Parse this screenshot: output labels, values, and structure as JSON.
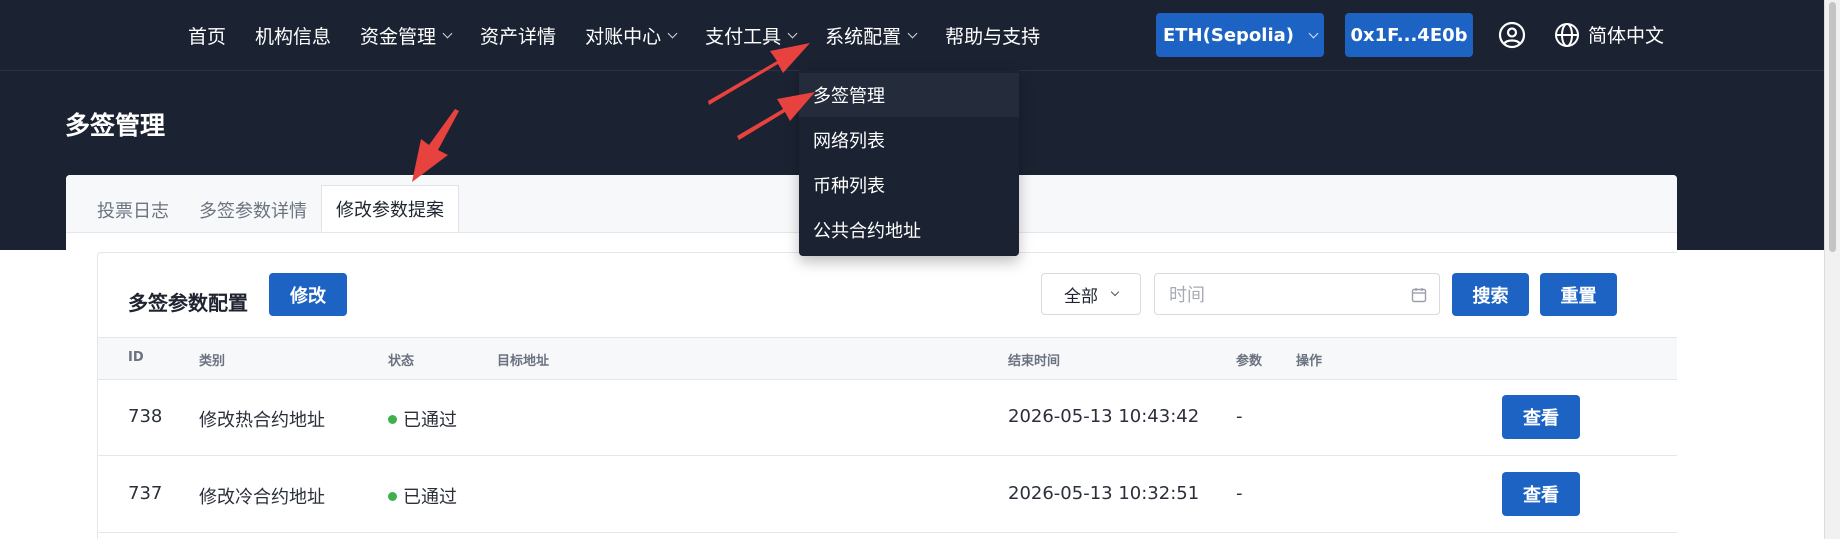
{
  "nav": {
    "items": [
      {
        "label": "首页",
        "dropdown": false
      },
      {
        "label": "机构信息",
        "dropdown": false
      },
      {
        "label": "资金管理",
        "dropdown": true
      },
      {
        "label": "资产详情",
        "dropdown": false
      },
      {
        "label": "对账中心",
        "dropdown": true
      },
      {
        "label": "支付工具",
        "dropdown": true
      },
      {
        "label": "系统配置",
        "dropdown": true
      },
      {
        "label": "帮助与支持",
        "dropdown": false
      }
    ],
    "network_button": "ETH(Sepolia)",
    "wallet_button": "0x1F...4E0b",
    "language": "简体中文"
  },
  "dropdown": {
    "items": [
      "多签管理",
      "网络列表",
      "币种列表",
      "公共合约地址"
    ]
  },
  "page": {
    "title": "多签管理",
    "tabs": [
      "投票日志",
      "多签参数详情",
      "修改参数提案"
    ],
    "active_tab": "修改参数提案"
  },
  "panel": {
    "title": "多签参数配置",
    "edit_button": "修改",
    "filter_value": "全部",
    "date_placeholder": "时间",
    "search_button": "搜索",
    "reset_button": "重置"
  },
  "table": {
    "headers": [
      "ID",
      "类别",
      "状态",
      "目标地址",
      "结束时间",
      "参数",
      "操作"
    ],
    "rows": [
      {
        "id": "738",
        "category": "修改热合约地址",
        "status": "已通过",
        "target": "",
        "end_time": "2026-05-13 10:43:42",
        "param": "-",
        "action": "查看"
      },
      {
        "id": "737",
        "category": "修改冷合约地址",
        "status": "已通过",
        "target": "",
        "end_time": "2026-05-13 10:32:51",
        "param": "-",
        "action": "查看"
      }
    ]
  },
  "colors": {
    "header_bg": "#1b2231",
    "primary": "#1d63c4",
    "status_success": "#3fb04a",
    "annotation_arrow": "#e8423f"
  }
}
